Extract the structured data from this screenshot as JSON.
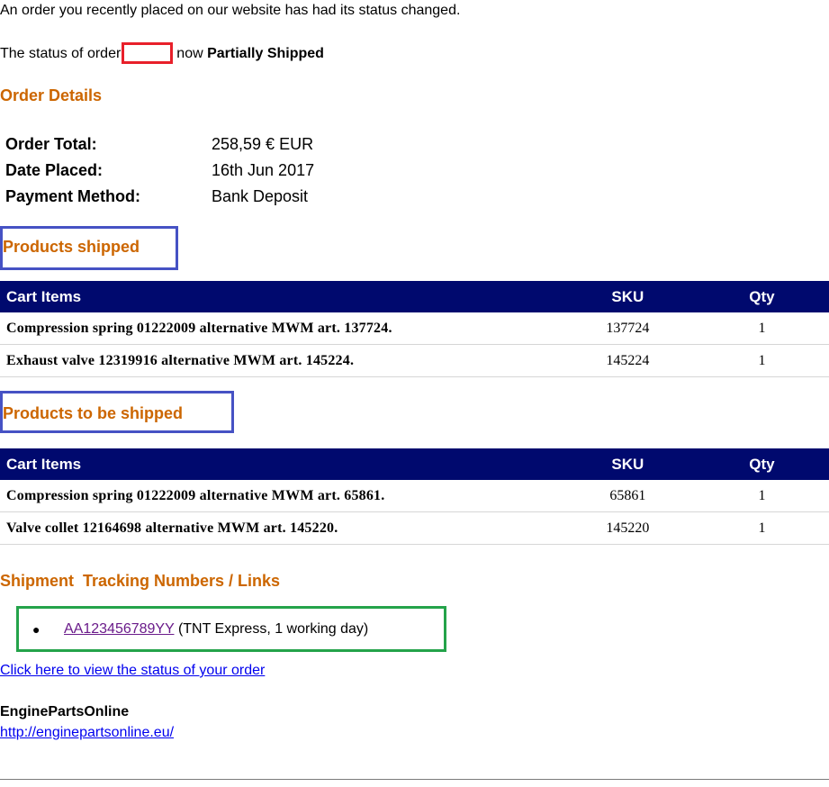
{
  "intro_text": "An order you recently placed on our website has had its status changed.",
  "status_line": {
    "prefix": "The status of order",
    "middle": "now",
    "status": "Partially Shipped"
  },
  "order_details": {
    "heading": "Order Details",
    "rows": [
      {
        "label": "Order Total:",
        "value": "258,59 € EUR"
      },
      {
        "label": "Date Placed:",
        "value": "16th Jun 2017"
      },
      {
        "label": "Payment Method:",
        "value": "Bank Deposit"
      }
    ]
  },
  "products_shipped": {
    "heading": "Products shipped",
    "columns": {
      "items": "Cart Items",
      "sku": "SKU",
      "qty": "Qty"
    },
    "rows": [
      {
        "name": "Compression spring 01222009 alternative MWM art. 137724.",
        "sku": "137724",
        "qty": "1"
      },
      {
        "name": "Exhaust valve 12319916 alternative MWM art. 145224.",
        "sku": "145224",
        "qty": "1"
      }
    ]
  },
  "products_to_ship": {
    "heading": "Products to be shipped",
    "columns": {
      "items": "Cart Items",
      "sku": "SKU",
      "qty": "Qty"
    },
    "rows": [
      {
        "name": "Compression spring 01222009 alternative MWM art. 65861.",
        "sku": "65861",
        "qty": "1"
      },
      {
        "name": "Valve collet 12164698 alternative MWM art. 145220.",
        "sku": "145220",
        "qty": "1"
      }
    ]
  },
  "tracking": {
    "heading": "Shipment  Tracking Numbers / Links",
    "number": "AA123456789YY",
    "details": "(TNT Express, 1 working day)"
  },
  "status_link_text": "Click here to view the status of your order",
  "brand_name": "EnginePartsOnline",
  "site_url": "http://enginepartsonline.eu/",
  "colors": {
    "heading_orange": "#cc6600",
    "table_header_navy": "#00096e",
    "redaction_red": "#e8202a",
    "highlight_blue": "#4652c4",
    "highlight_green": "#24a34a",
    "link_blue": "#0000ee",
    "visited_link_purple": "#6a1b8a"
  }
}
